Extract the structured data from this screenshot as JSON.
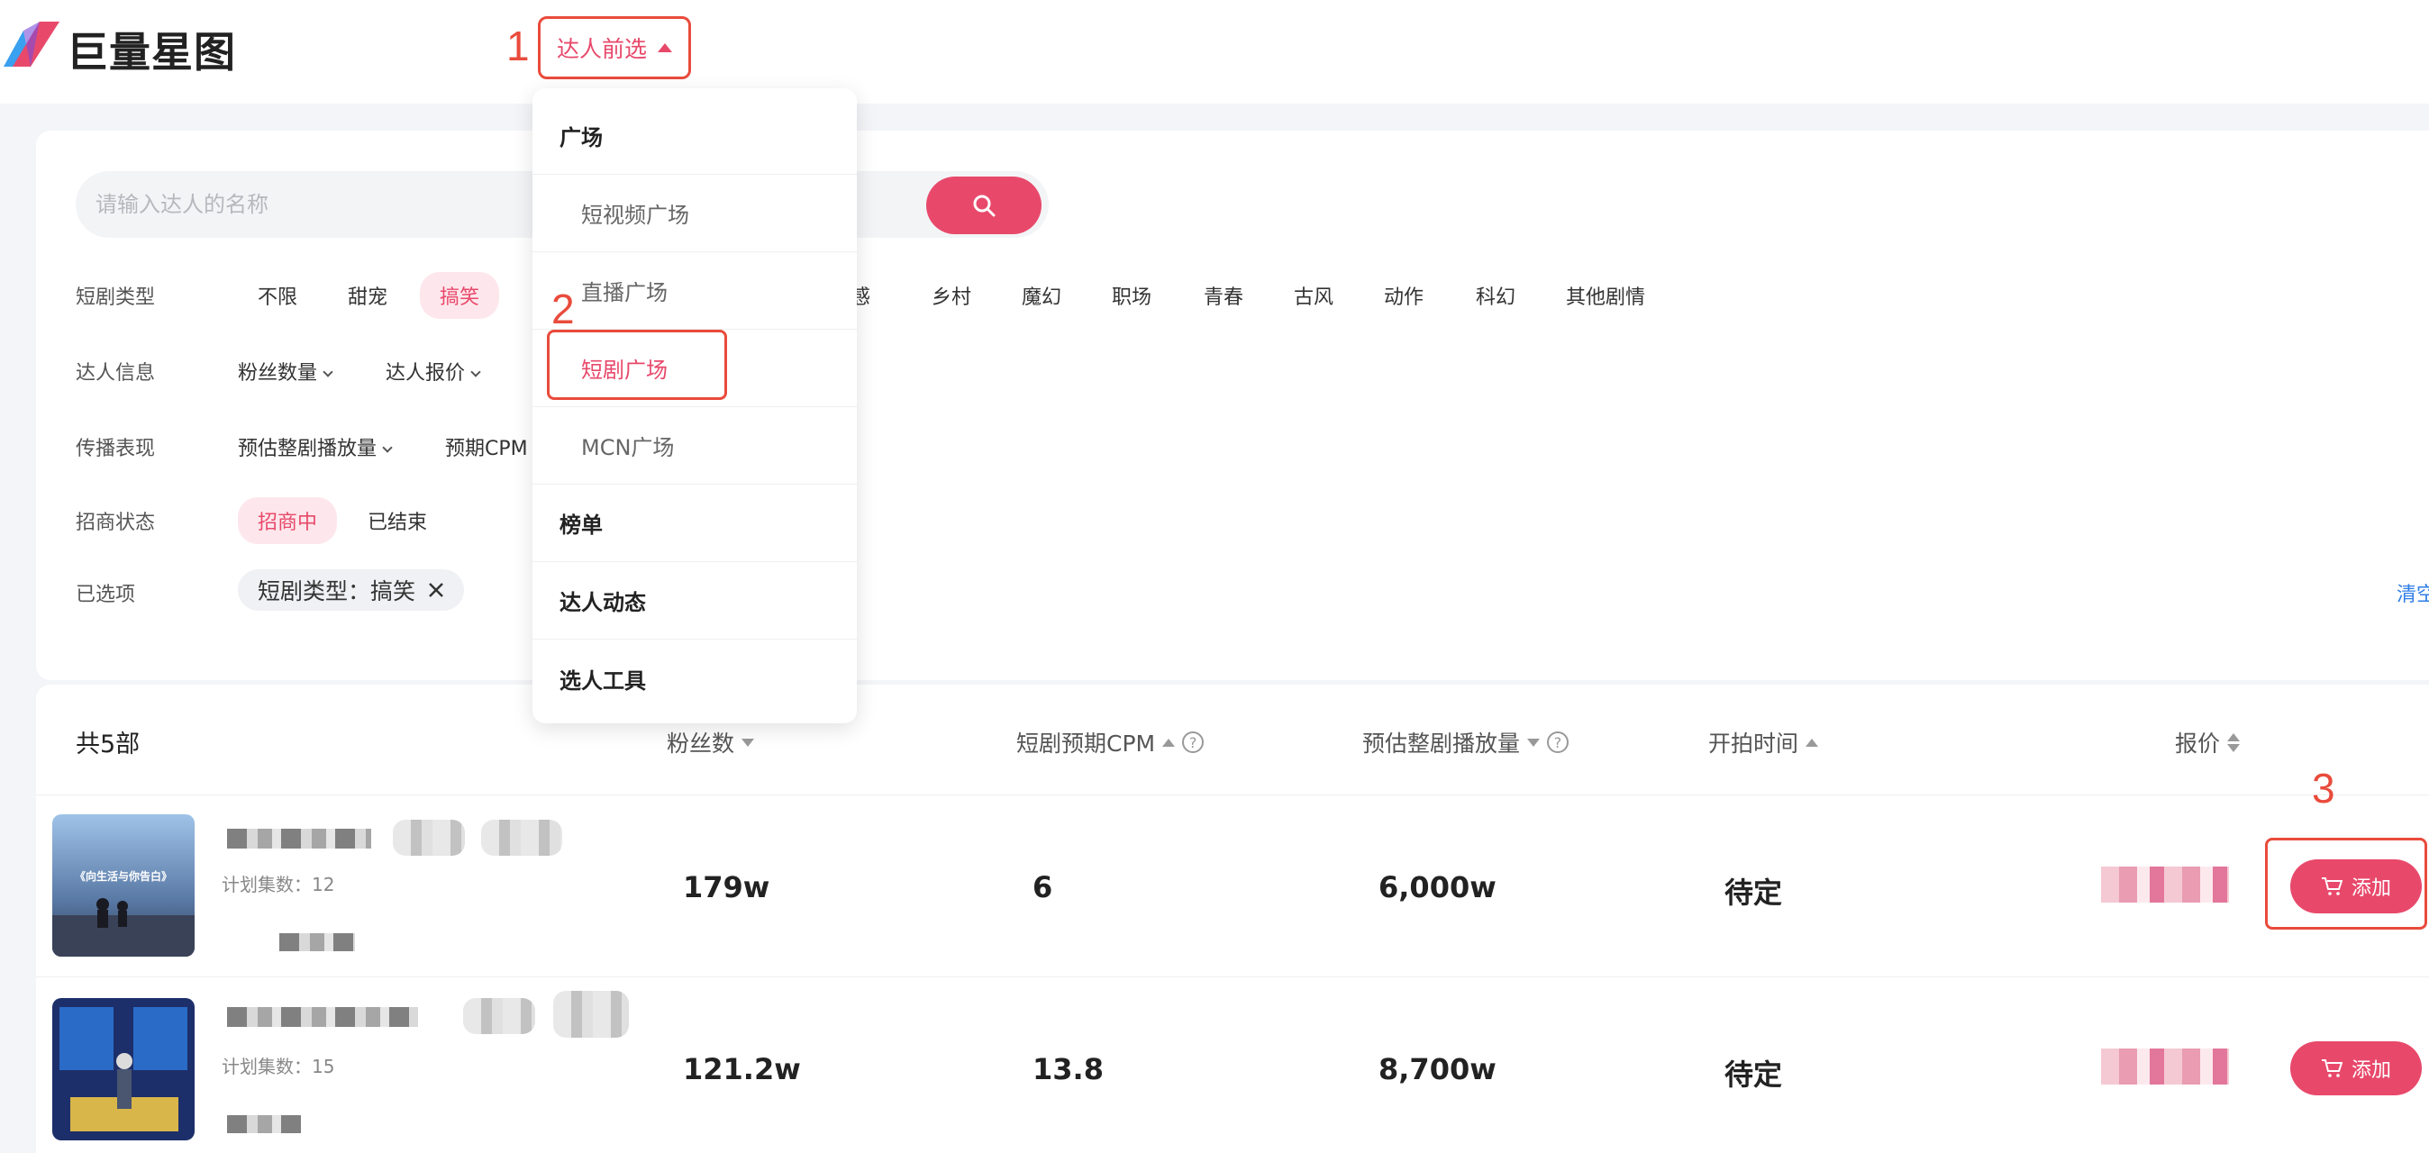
{
  "app": {
    "logo_text": "巨量星图"
  },
  "nav": {
    "active_label": "达人前选"
  },
  "annotations": [
    "1",
    "2",
    "3"
  ],
  "search": {
    "placeholder": "请输入达人的名称"
  },
  "filters": {
    "genre_label": "短剧类型",
    "genres": [
      "不限",
      "甜宠",
      "搞笑",
      "感",
      "乡村",
      "魔幻",
      "职场",
      "青春",
      "古风",
      "动作",
      "科幻",
      "其他剧情"
    ],
    "genre_active": "搞笑",
    "talent_info_label": "达人信息",
    "talent_info": [
      "粉丝数量",
      "达人报价"
    ],
    "perf_label": "传播表现",
    "perf": [
      "预估整剧播放量",
      "预期CPM"
    ],
    "status_label": "招商状态",
    "status_options": [
      "招商中",
      "已结束"
    ],
    "selected_label": "已选项",
    "selected_chip": "短剧类型：搞笑",
    "clear_all": "清空"
  },
  "dropdown": {
    "items": [
      {
        "label": "广场",
        "kind": "head"
      },
      {
        "label": "短视频广场",
        "kind": "sub"
      },
      {
        "label": "直播广场",
        "kind": "sub"
      },
      {
        "label": "短剧广场",
        "kind": "sub",
        "selected": true
      },
      {
        "label": "MCN广场",
        "kind": "sub"
      },
      {
        "label": "榜单",
        "kind": "head"
      },
      {
        "label": "达人动态",
        "kind": "head"
      },
      {
        "label": "选人工具",
        "kind": "head"
      }
    ]
  },
  "results": {
    "total": "共5部",
    "headers": {
      "fans": "粉丝数",
      "cpm": "短剧预期CPM",
      "plays": "预估整剧播放量",
      "start": "开拍时间",
      "price": "报价"
    },
    "rows": [
      {
        "cover_title": "《向生活与你告白》",
        "plan_count": "计划集数：12",
        "fans": "179w",
        "cpm": "6",
        "plays": "6,000w",
        "start": "待定",
        "action": "添加"
      },
      {
        "cover_title": "",
        "plan_count": "计划集数：15",
        "fans": "121.2w",
        "cpm": "13.8",
        "plays": "8,700w",
        "start": "待定",
        "action": "添加"
      }
    ]
  },
  "colors": {
    "accent": "#e8496b",
    "annotation": "#e94b3c",
    "link": "#2f7ee6"
  }
}
